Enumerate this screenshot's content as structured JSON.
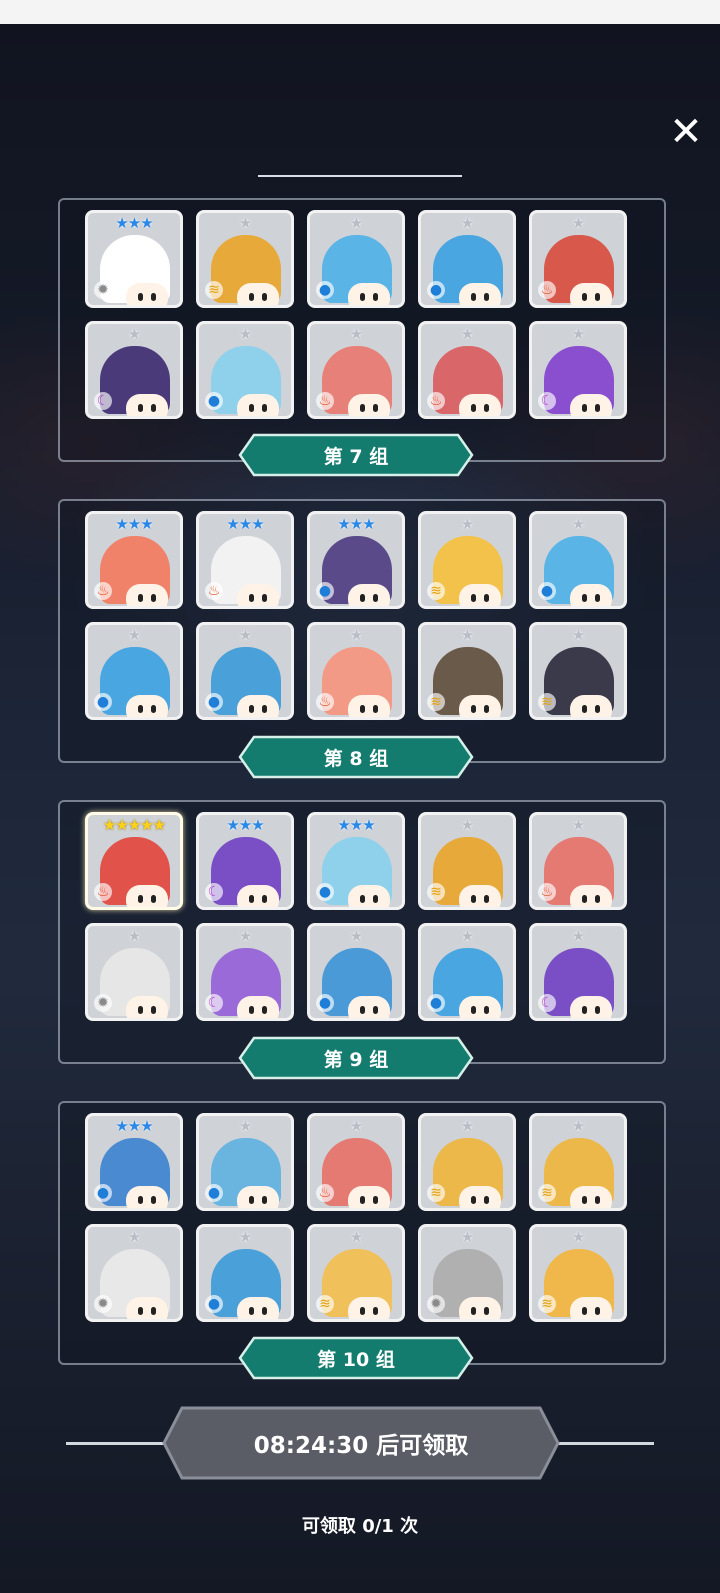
{
  "close_label": "✕",
  "groups": [
    {
      "label": "第 7 组",
      "units": [
        {
          "stars": 3,
          "star_color": "blue",
          "element": "light",
          "icon": "hooded-ghost-knight",
          "color": "#ffffff"
        },
        {
          "stars": 1,
          "star_color": "silver",
          "element": "wind",
          "icon": "yellow-tree-stump",
          "color": "#e7a93a"
        },
        {
          "stars": 1,
          "star_color": "silver",
          "element": "water",
          "icon": "blue-cactus",
          "color": "#5ab4e6"
        },
        {
          "stars": 1,
          "star_color": "silver",
          "element": "water",
          "icon": "blue-skull",
          "color": "#4aa6e0"
        },
        {
          "stars": 1,
          "star_color": "silver",
          "element": "fire",
          "icon": "red-hat-boy",
          "color": "#d8594b"
        },
        {
          "stars": 1,
          "star_color": "silver",
          "element": "dark",
          "icon": "purple-hair-girl",
          "color": "#4b3a7a"
        },
        {
          "stars": 1,
          "star_color": "silver",
          "element": "water",
          "icon": "ice-princess",
          "color": "#8fd0ea"
        },
        {
          "stars": 1,
          "star_color": "silver",
          "element": "fire",
          "icon": "winged-helmet-knight",
          "color": "#e8807a"
        },
        {
          "stars": 1,
          "star_color": "silver",
          "element": "fire",
          "icon": "red-totem-pole",
          "color": "#d9676a"
        },
        {
          "stars": 1,
          "star_color": "silver",
          "element": "dark",
          "icon": "purple-eyepatch-monster",
          "color": "#8a4fcf"
        }
      ]
    },
    {
      "label": "第 8 组",
      "units": [
        {
          "stars": 3,
          "star_color": "blue",
          "element": "fire",
          "icon": "red-curly-hair-girl",
          "color": "#f0826a"
        },
        {
          "stars": 3,
          "star_color": "blue",
          "element": "fire",
          "icon": "white-horned-demon",
          "color": "#f2f2f2"
        },
        {
          "stars": 3,
          "star_color": "blue",
          "element": "water",
          "icon": "skull-witch-hat",
          "color": "#5a4a8a"
        },
        {
          "stars": 1,
          "star_color": "silver",
          "element": "wind",
          "icon": "blonde-bow-girl",
          "color": "#f2c24a"
        },
        {
          "stars": 1,
          "star_color": "silver",
          "element": "water",
          "icon": "blue-cactus",
          "color": "#5ab4e6"
        },
        {
          "stars": 1,
          "star_color": "silver",
          "element": "water",
          "icon": "blue-bear",
          "color": "#4aa6e0"
        },
        {
          "stars": 1,
          "star_color": "silver",
          "element": "water",
          "icon": "blue-dragon",
          "color": "#4aa0d8"
        },
        {
          "stars": 1,
          "star_color": "silver",
          "element": "fire",
          "icon": "pink-fox-girl",
          "color": "#f29a86"
        },
        {
          "stars": 1,
          "star_color": "silver",
          "element": "wind",
          "icon": "shield-knight",
          "color": "#6a5a4a"
        },
        {
          "stars": 1,
          "star_color": "silver",
          "element": "wind",
          "icon": "black-gold-blob",
          "color": "#3a3a4a"
        }
      ]
    },
    {
      "label": "第 9 组",
      "units": [
        {
          "stars": 5,
          "star_color": "gold",
          "element": "fire",
          "icon": "red-lion",
          "color": "#e0524a"
        },
        {
          "stars": 3,
          "star_color": "blue",
          "element": "dark",
          "icon": "purple-ninja",
          "color": "#7a4fc6"
        },
        {
          "stars": 3,
          "star_color": "blue",
          "element": "water",
          "icon": "blue-unicorn",
          "color": "#8fd0ea"
        },
        {
          "stars": 1,
          "star_color": "silver",
          "element": "wind",
          "icon": "yellow-tree-stump",
          "color": "#e7a93a"
        },
        {
          "stars": 1,
          "star_color": "silver",
          "element": "fire",
          "icon": "red-cactus",
          "color": "#e47a72"
        },
        {
          "stars": 1,
          "star_color": "silver",
          "element": "light",
          "icon": "white-bone-beast",
          "color": "#e6e6e6"
        },
        {
          "stars": 1,
          "star_color": "silver",
          "element": "dark",
          "icon": "purple-horned-blob",
          "color": "#9a6ad8"
        },
        {
          "stars": 1,
          "star_color": "silver",
          "element": "water",
          "icon": "blue-totem-pole",
          "color": "#4a9ad8"
        },
        {
          "stars": 1,
          "star_color": "silver",
          "element": "water",
          "icon": "blue-eyepatch-monster",
          "color": "#4aa6e0"
        },
        {
          "stars": 1,
          "star_color": "silver",
          "element": "dark",
          "icon": "purple-robot",
          "color": "#7a4fc6"
        }
      ]
    },
    {
      "label": "第 10 组",
      "units": [
        {
          "stars": 3,
          "star_color": "blue",
          "element": "water",
          "icon": "blue-wolf",
          "color": "#4a8ad0"
        },
        {
          "stars": 1,
          "star_color": "silver",
          "element": "water",
          "icon": "bandaged-mummy",
          "color": "#6ab4e0"
        },
        {
          "stars": 1,
          "star_color": "silver",
          "element": "fire",
          "icon": "red-cactus",
          "color": "#e47a72"
        },
        {
          "stars": 1,
          "star_color": "silver",
          "element": "wind",
          "icon": "yellow-cactus",
          "color": "#ecb84a"
        },
        {
          "stars": 1,
          "star_color": "silver",
          "element": "wind",
          "icon": "yellow-cactus",
          "color": "#ecb84a"
        },
        {
          "stars": 1,
          "star_color": "silver",
          "element": "light",
          "icon": "white-skull",
          "color": "#e8e8e8"
        },
        {
          "stars": 1,
          "star_color": "silver",
          "element": "water",
          "icon": "blue-dragon",
          "color": "#4aa0d8"
        },
        {
          "stars": 1,
          "star_color": "silver",
          "element": "wind",
          "icon": "golden-hood-girl",
          "color": "#f0c05a"
        },
        {
          "stars": 1,
          "star_color": "silver",
          "element": "light",
          "icon": "grey-totem-pole",
          "color": "#b0b0b0"
        },
        {
          "stars": 1,
          "star_color": "silver",
          "element": "wind",
          "icon": "yellow-eyepatch-monster",
          "color": "#f0b84a"
        }
      ]
    }
  ],
  "claim_button": "08:24:30 后可领取",
  "claim_count": "可领取 0/1 次",
  "colors": {
    "banner": "#137c6e",
    "banner_border": "#d6efe9",
    "claim_button": "#5a5d66"
  }
}
